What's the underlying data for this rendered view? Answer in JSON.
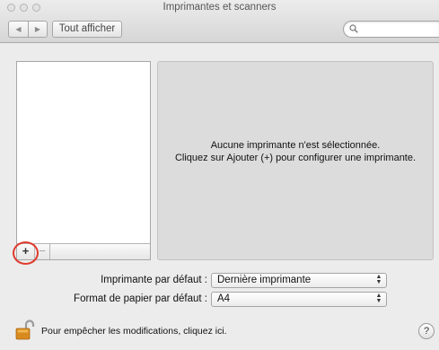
{
  "window": {
    "title": "Imprimantes et scanners"
  },
  "toolbar": {
    "back_glyph": "◀",
    "forward_glyph": "▶",
    "show_all_label": "Tout afficher",
    "search_placeholder": ""
  },
  "printer_list": {
    "items": [],
    "add_label": "+",
    "remove_label": "−"
  },
  "detail": {
    "message_line1": "Aucune imprimante n'est sélectionnée.",
    "message_line2": "Cliquez sur Ajouter (+) pour configurer une imprimante."
  },
  "defaults": {
    "printer_label": "Imprimante par défaut :",
    "printer_value": "Dernière imprimante",
    "paper_label": "Format de papier par défaut :",
    "paper_value": "A4"
  },
  "lock": {
    "label": "Pour empêcher les modifications, cliquez ici.",
    "state": "unlocked"
  },
  "help": {
    "label": "?"
  },
  "icons": {
    "search": "search-icon",
    "lock": "lock-icon"
  },
  "colors": {
    "highlight": "#e03b2e",
    "pane": "#dcdcdc",
    "lock_body": "#d98a1e"
  }
}
